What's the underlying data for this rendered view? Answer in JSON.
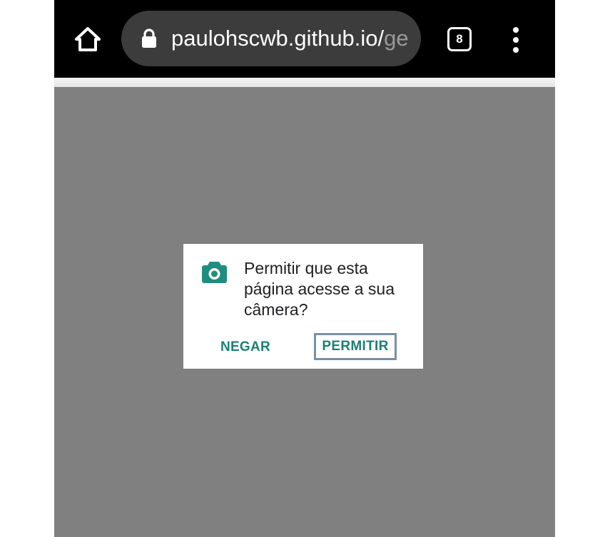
{
  "browser": {
    "url_visible": "paulohscwb.github.io/",
    "url_faded": "ge",
    "tab_count": "8",
    "icons": {
      "home": "home-icon",
      "lock": "lock-icon",
      "tabs": "tab-switcher-icon",
      "menu": "more-vert-icon"
    }
  },
  "permission_dialog": {
    "icon": "camera-icon",
    "message": "Permitir que esta página acesse a sua câmera?",
    "deny_label": "NEGAR",
    "allow_label": "PERMITIR"
  },
  "colors": {
    "toolbar": "#000000",
    "urlbar": "#3c3c3c",
    "page_overlay": "#808080",
    "accent": "#1a8074",
    "focus_outline": "#7890a6"
  }
}
